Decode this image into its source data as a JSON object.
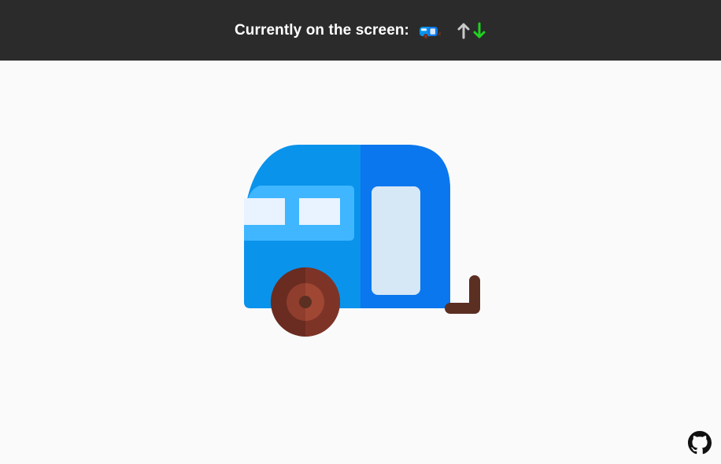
{
  "header": {
    "label": "Currently on the screen:",
    "emoji_icon": "camper-trailer-icon",
    "arrow_up_color": "#c9c9c9",
    "arrow_down_color": "#1fd31f"
  },
  "main": {
    "emoji_icon": "camper-trailer-icon"
  },
  "footer": {
    "github_icon": "github-icon"
  },
  "colors": {
    "topbar_bg": "#2b2b2b",
    "page_bg": "#fafafa",
    "trailer_blue": "#0a93eb",
    "trailer_blue_dark": "#0b77ee",
    "window_blue": "#3fb6ff",
    "window_light": "#e8f3ff",
    "door_light": "#d6e7f6",
    "wheel_dark": "#6a2b20",
    "wheel_mid": "#8f3d2d",
    "hitch_brown": "#5b2f22"
  }
}
